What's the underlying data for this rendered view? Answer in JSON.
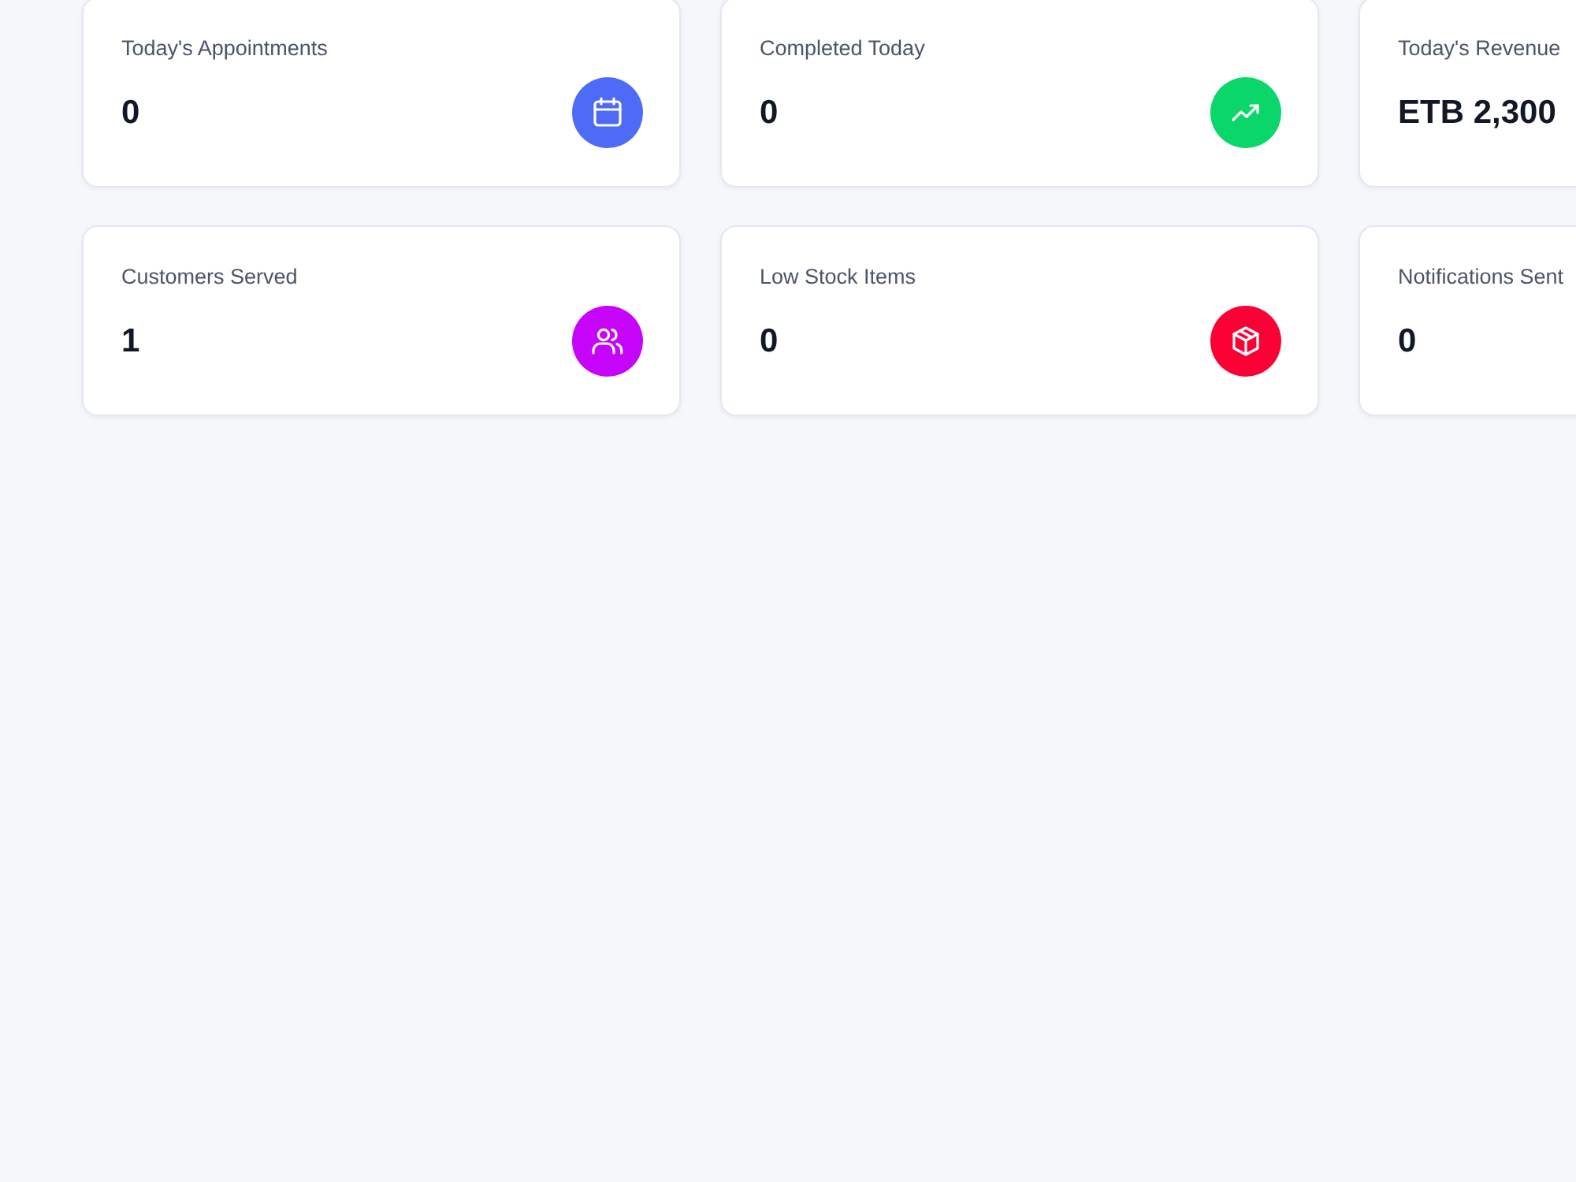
{
  "cards": [
    {
      "label": "Today's Appointments",
      "value": "0",
      "color": "#4d6bf7"
    },
    {
      "label": "Completed Today",
      "value": "0",
      "color": "#0ad66a"
    },
    {
      "label": "Today's Revenue",
      "value": "ETB 2,300"
    },
    {
      "label": "Customers Served",
      "value": "1",
      "color": "#c604fa"
    },
    {
      "label": "Low Stock Items",
      "value": "0",
      "color": "#fb0034"
    },
    {
      "label": "Notifications Sent",
      "value": "0"
    }
  ]
}
